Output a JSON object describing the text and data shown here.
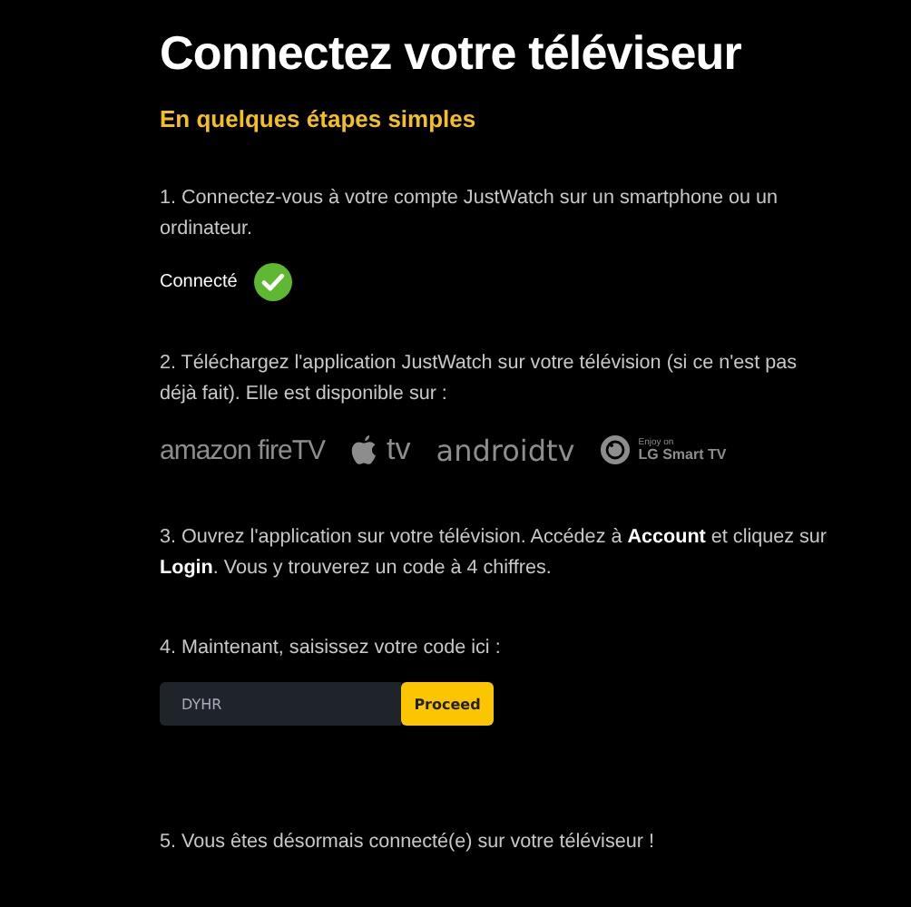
{
  "title": "Connectez votre téléviseur",
  "subtitle": "En quelques étapes simples",
  "steps": [
    {
      "kind": "status",
      "text": "1. Connectez-vous à votre compte JustWatch sur un smartphone ou un ordinateur.",
      "status": {
        "label": "Connecté",
        "connected": true
      }
    },
    {
      "kind": "platforms",
      "text": "2. Téléchargez l'application JustWatch sur votre télévision (si ce n'est pas déjà fait). Elle est disponible sur :",
      "platforms": [
        {
          "kind": "amazon",
          "text": "amazon fireTV"
        },
        {
          "kind": "apple",
          "text": "tv"
        },
        {
          "kind": "android",
          "text": "androidtv"
        },
        {
          "kind": "lg",
          "small": "Enjoy on",
          "text": "LG Smart TV"
        }
      ]
    },
    {
      "kind": "plain",
      "text": "3. Ouvrez l'application sur votre télévision. Accédez à **Account** et cliquez sur **Login**. Vous y trouverez un code à 4 chiffres."
    },
    {
      "kind": "code",
      "text": "4. Maintenant, saisissez votre code ici :",
      "code": {
        "value": "DYHR",
        "button": "Proceed"
      }
    },
    {
      "kind": "plain",
      "text": "5. Vous êtes désormais connecté(e) sur votre téléviseur !"
    }
  ]
}
